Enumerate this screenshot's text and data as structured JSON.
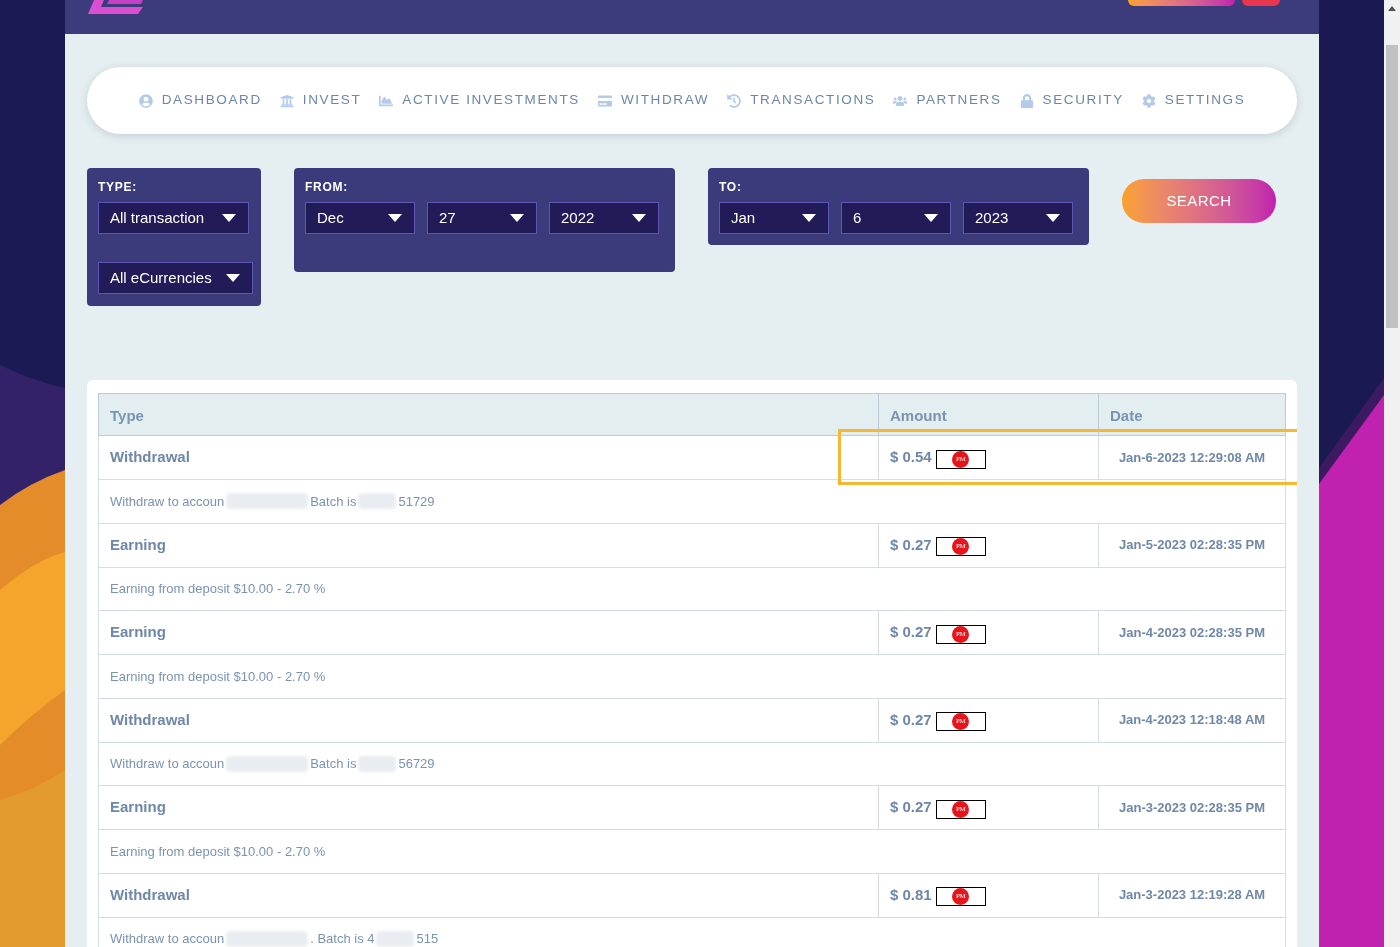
{
  "nav": [
    {
      "label": "DASHBOARD"
    },
    {
      "label": "INVEST"
    },
    {
      "label": "ACTIVE INVESTMENTS"
    },
    {
      "label": "WITHDRAW"
    },
    {
      "label": "TRANSACTIONS"
    },
    {
      "label": "PARTNERS"
    },
    {
      "label": "SECURITY"
    },
    {
      "label": "SETTINGS"
    }
  ],
  "filters": {
    "type": {
      "label": "TYPE:",
      "selects": [
        "All transaction",
        "All eCurrencies"
      ]
    },
    "from": {
      "label": "FROM:",
      "selects": [
        "Dec",
        "27",
        "2022"
      ]
    },
    "to": {
      "label": "TO:",
      "selects": [
        "Jan",
        "6",
        "2023"
      ]
    },
    "search_button": "SEARCH"
  },
  "table": {
    "columns": [
      "Type",
      "Amount",
      "Date"
    ],
    "rows": [
      {
        "type": "Withdrawal",
        "amount": "$ 0.54",
        "currency": "PM",
        "date": "Jan-6-2023 12:29:08 AM",
        "highlighted": true,
        "detail": [
          {
            "kind": "text",
            "text": "Withdraw to accoun"
          },
          {
            "kind": "blur"
          },
          {
            "kind": "text",
            "text": "Batch is"
          },
          {
            "kind": "blur"
          },
          {
            "kind": "text",
            "text": "51729"
          }
        ]
      },
      {
        "type": "Earning",
        "amount": "$ 0.27",
        "currency": "PM",
        "date": "Jan-5-2023 02:28:35 PM",
        "highlighted": false,
        "detail": [
          {
            "kind": "text",
            "text": "Earning from deposit $10.00 - 2.70 %"
          }
        ]
      },
      {
        "type": "Earning",
        "amount": "$ 0.27",
        "currency": "PM",
        "date": "Jan-4-2023 02:28:35 PM",
        "highlighted": false,
        "detail": [
          {
            "kind": "text",
            "text": "Earning from deposit $10.00 - 2.70 %"
          }
        ]
      },
      {
        "type": "Withdrawal",
        "amount": "$ 0.27",
        "currency": "PM",
        "date": "Jan-4-2023 12:18:48 AM",
        "highlighted": false,
        "detail": [
          {
            "kind": "text",
            "text": "Withdraw to accoun"
          },
          {
            "kind": "blur"
          },
          {
            "kind": "text",
            "text": "Batch is"
          },
          {
            "kind": "blur"
          },
          {
            "kind": "text",
            "text": "56729"
          }
        ]
      },
      {
        "type": "Earning",
        "amount": "$ 0.27",
        "currency": "PM",
        "date": "Jan-3-2023 02:28:35 PM",
        "highlighted": false,
        "detail": [
          {
            "kind": "text",
            "text": "Earning from deposit $10.00 - 2.70 %"
          }
        ]
      },
      {
        "type": "Withdrawal",
        "amount": "$ 0.81",
        "currency": "PM",
        "date": "Jan-3-2023 12:19:28 AM",
        "highlighted": false,
        "detail": [
          {
            "kind": "text",
            "text": "Withdraw to accoun"
          },
          {
            "kind": "blur"
          },
          {
            "kind": "text",
            "text": ". Batch is 4"
          },
          {
            "kind": "blur"
          },
          {
            "kind": "text",
            "text": "515"
          }
        ]
      }
    ]
  }
}
